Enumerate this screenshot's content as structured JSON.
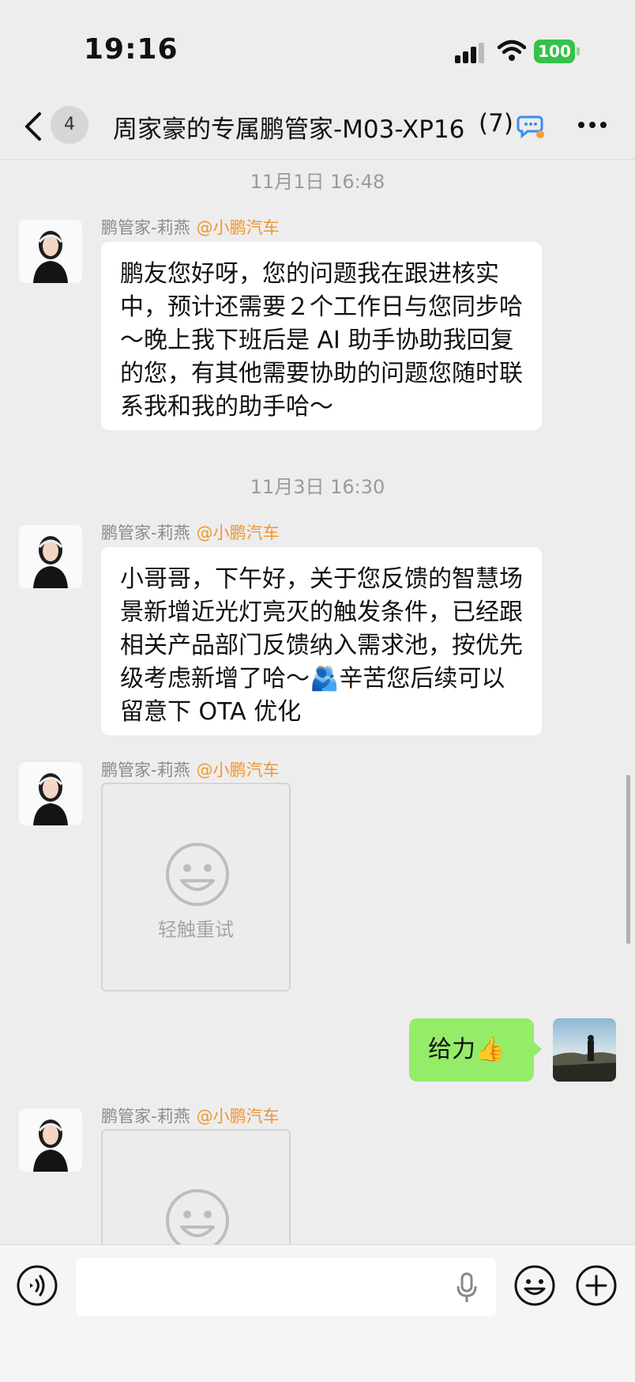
{
  "status_bar": {
    "time": "19:16",
    "battery": "100"
  },
  "header": {
    "unread_count": "4",
    "title": "周家豪的专属鹏管家-M03-XP16",
    "member_count": "(7)"
  },
  "messages": {
    "time1": "11月1日 16:48",
    "time2": "11月3日 16:30",
    "sender_name": "鹏管家-莉燕",
    "sender_org": "@小鹏汽车",
    "msg1": "鹏友您好呀，您的问题我在跟进核实中，预计还需要２个工作日与您同步哈～晚上我下班后是 AI 助手协助我回复的您，有其他需要协助的问题您随时联系我和我的助手哈～",
    "msg2": "小哥哥，下午好，关于您反馈的智慧场景新增近光灯亮灭的触发条件，已经跟相关产品部门反馈纳入需求池，按优先级考虑新增了哈～🫂辛苦您后续可以留意下 OTA 优化",
    "retry_label": "轻触重试",
    "my_msg": "给力👍"
  },
  "input_bar": {
    "placeholder": ""
  },
  "colors": {
    "background": "#ededed",
    "my_bubble": "#95ec69",
    "org_tag": "#f0962e",
    "battery": "#36c24a"
  },
  "icons": [
    "back-icon",
    "wifi-icon",
    "signal-icon",
    "ai-chat-icon",
    "more-icon",
    "smiley-icon",
    "voice-icon",
    "mic-icon",
    "emoji-icon",
    "plus-icon"
  ]
}
